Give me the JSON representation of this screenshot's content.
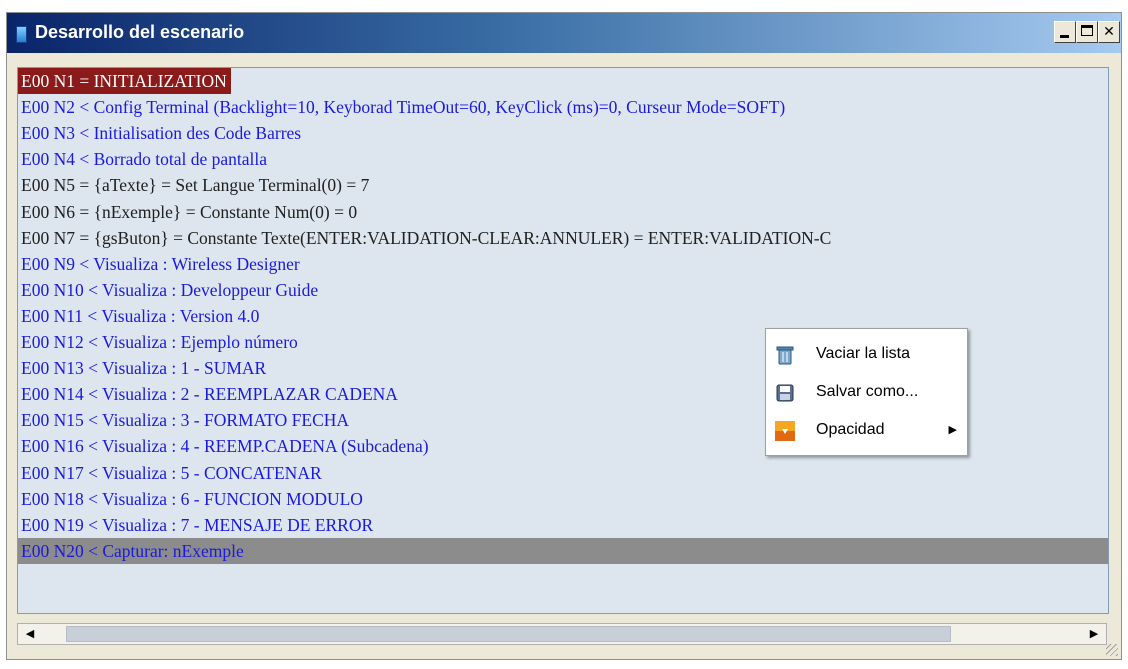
{
  "window": {
    "title": "Desarrollo del escenario",
    "controls": {
      "close_glyph": "✕"
    }
  },
  "log_lines": [
    {
      "text": "E00 N1 = INITIALIZATION",
      "style": "highlight"
    },
    {
      "text": "E00 N2 < Config Terminal (Backlight=10, Keyborad TimeOut=60, KeyClick (ms)=0, Curseur Mode=SOFT)",
      "style": "blue"
    },
    {
      "text": "E00 N3 < Initialisation des Code Barres",
      "style": "blue"
    },
    {
      "text": "E00 N4 < Borrado total de pantalla",
      "style": "blue"
    },
    {
      "text": "E00 N5 = {aTexte} = Set Langue Terminal(0) = 7",
      "style": "black"
    },
    {
      "text": "E00 N6 = {nExemple} = Constante Num(0) = 0",
      "style": "black"
    },
    {
      "text": "E00 N7 = {gsButon} = Constante Texte(ENTER:VALIDATION-CLEAR:ANNULER) = ENTER:VALIDATION-C",
      "style": "black"
    },
    {
      "text": "E00 N9 < Visualiza :        Wireless Designer",
      "style": "blue"
    },
    {
      "text": "E00 N10 < Visualiza :        Developpeur Guide",
      "style": "blue"
    },
    {
      "text": "E00 N11 < Visualiza :            Version 4.0",
      "style": "blue"
    },
    {
      "text": "E00 N12 < Visualiza :          Ejemplo número",
      "style": "blue"
    },
    {
      "text": "E00 N13 < Visualiza : 1 - SUMAR",
      "style": "blue"
    },
    {
      "text": "E00 N14 < Visualiza : 2 - REEMPLAZAR CADENA",
      "style": "blue"
    },
    {
      "text": "E00 N15 < Visualiza : 3 - FORMATO FECHA",
      "style": "blue"
    },
    {
      "text": "E00 N16 < Visualiza : 4 - REEMP.CADENA (Subcadena)",
      "style": "blue"
    },
    {
      "text": "E00 N17 < Visualiza : 5 - CONCATENAR",
      "style": "blue"
    },
    {
      "text": "E00 N18 < Visualiza : 6 - FUNCION MODULO",
      "style": "blue"
    },
    {
      "text": "E00 N19 < Visualiza : 7 - MENSAJE DE ERROR",
      "style": "blue"
    },
    {
      "text": "E00 N20 < Capturar: nExemple",
      "style": "selected"
    }
  ],
  "context_menu": {
    "items": [
      {
        "label": "Vaciar la lista",
        "icon": "trash-icon"
      },
      {
        "label": "Salvar como...",
        "icon": "floppy-disk-icon"
      },
      {
        "label": "Opacidad",
        "icon": "opacity-icon",
        "submenu_arrow": "▶"
      }
    ]
  },
  "scrollbar": {
    "left_arrow": "◀",
    "right_arrow": "▶"
  },
  "colors": {
    "highlight_bg": "#8b1a1a",
    "selected_bg": "#8c8c8c",
    "text_blue": "#1a1adc",
    "list_bg": "#dde6ee"
  }
}
